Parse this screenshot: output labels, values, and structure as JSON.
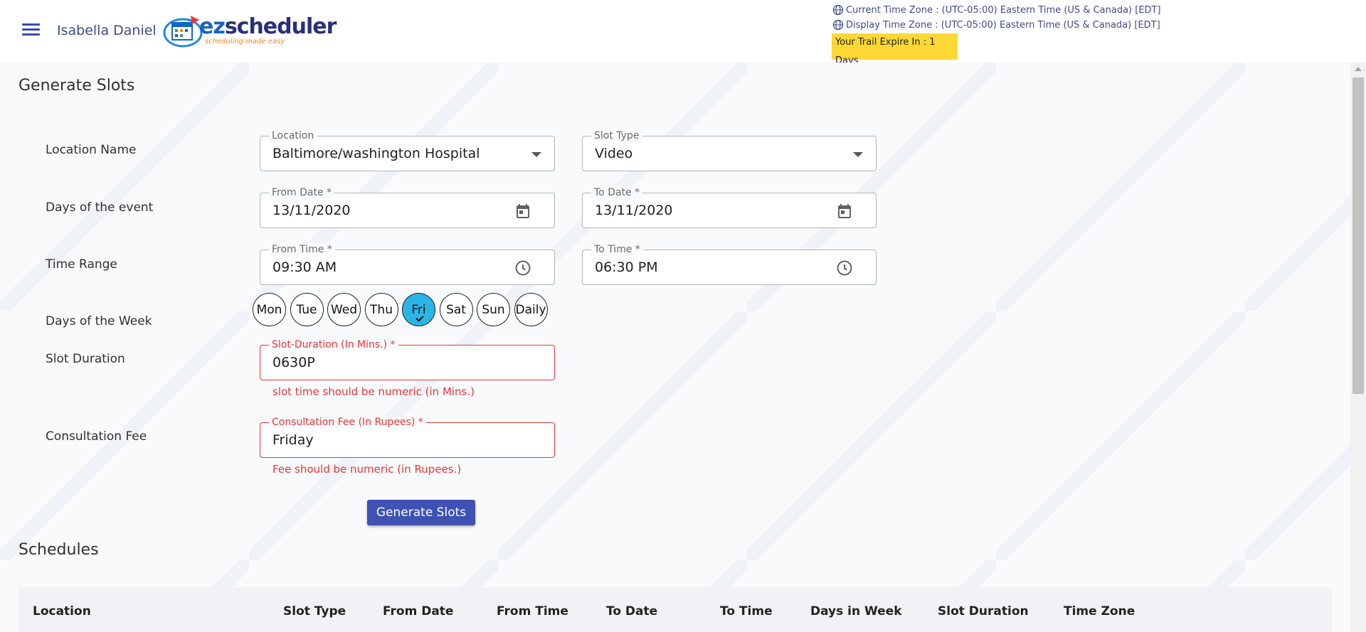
{
  "header": {
    "username": "Isabella Daniel",
    "logo": {
      "ez": "ez",
      "scheduler": "scheduler",
      "tagline": "scheduling made easy"
    },
    "current_tz": "Current Time Zone : (UTC-05:00) Eastern Time (US & Canada) [EDT]",
    "display_tz": "Display Time Zone : (UTC-05:00) Eastern Time (US & Canada) [EDT]",
    "trial": "Your Trail Expire In : 1 Days",
    "icons": [
      "menu-icon",
      "globe-icon"
    ]
  },
  "generate": {
    "title": "Generate Slots",
    "labels": {
      "location_name": "Location Name",
      "days_event": "Days of the event",
      "time_range": "Time Range",
      "days_week": "Days of the Week",
      "slot_duration": "Slot Duration",
      "consultation_fee": "Consultation Fee"
    },
    "location": {
      "label": "Location",
      "value": "Baltimore/washington Hospital"
    },
    "slot_type": {
      "label": "Slot Type",
      "value": "Video"
    },
    "from_date": {
      "label": "From Date *",
      "value": "13/11/2020"
    },
    "to_date": {
      "label": "To Date *",
      "value": "13/11/2020"
    },
    "from_time": {
      "label": "From Time *",
      "value": "09:30 AM"
    },
    "to_time": {
      "label": "To Time *",
      "value": "06:30 PM"
    },
    "days": [
      {
        "label": "Mon",
        "selected": false
      },
      {
        "label": "Tue",
        "selected": false
      },
      {
        "label": "Wed",
        "selected": false
      },
      {
        "label": "Thu",
        "selected": false
      },
      {
        "label": "Fri",
        "selected": true
      },
      {
        "label": "Sat",
        "selected": false
      },
      {
        "label": "Sun",
        "selected": false
      },
      {
        "label": "Daily",
        "selected": false
      }
    ],
    "duration": {
      "label": "Slot-Duration (In Mins.) *",
      "value": "0630P",
      "error": "slot time should be numeric (in Mins.)"
    },
    "fee": {
      "label": "Consultation Fee (In Rupees) *",
      "value": "Friday",
      "error": "Fee should be numeric (in Rupees.)"
    },
    "button": "Generate Slots"
  },
  "schedules": {
    "title": "Schedules",
    "columns": [
      "Location",
      "Slot Type",
      "From Date",
      "From Time",
      "To Date",
      "To Time",
      "Days in Week",
      "Slot Duration",
      "Time Zone"
    ]
  },
  "colors": {
    "accent": "#3f51b5",
    "selected_day": "#29b6e6",
    "error": "#e53935",
    "trial_bg": "#fdd835"
  }
}
